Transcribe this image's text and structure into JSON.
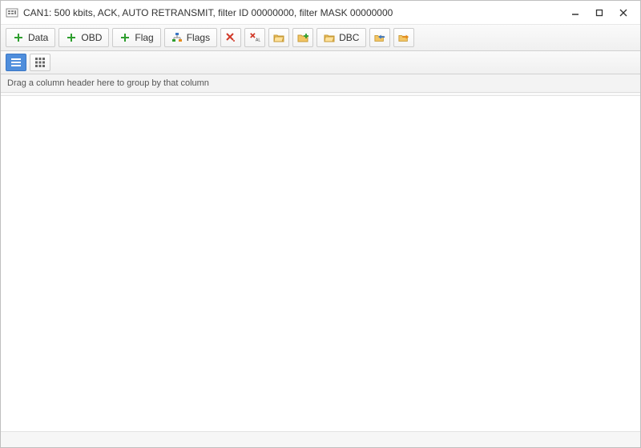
{
  "window": {
    "title": "CAN1: 500 kbits, ACK, AUTO RETRANSMIT, filter ID 00000000, filter MASK 00000000"
  },
  "toolbar": {
    "data_label": "Data",
    "obd_label": "OBD",
    "flag_label": "Flag",
    "flags_label": "Flags",
    "dbc_label": "DBC"
  },
  "grid": {
    "group_prompt": "Drag a column header here to group by that column"
  }
}
